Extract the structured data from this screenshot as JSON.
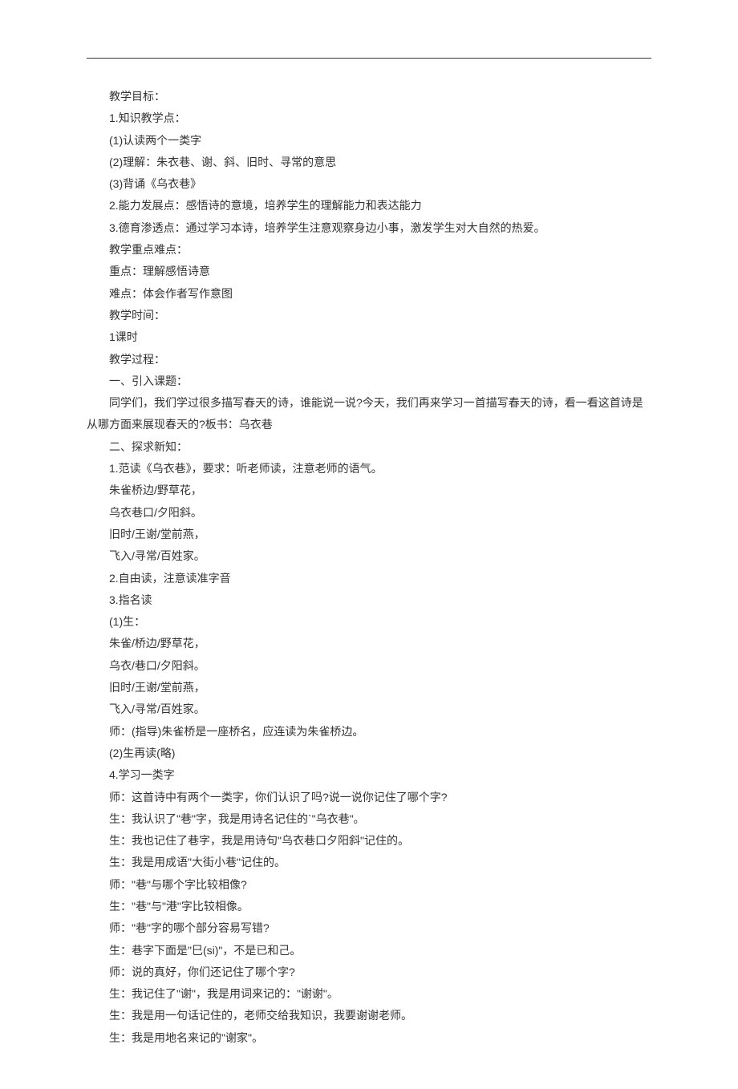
{
  "lines": [
    "教学目标：",
    "1.知识教学点：",
    "(1)认读两个一类字",
    "(2)理解：朱衣巷、谢、斜、旧时、寻常的意思",
    "(3)背诵《乌衣巷》",
    "2.能力发展点：感悟诗的意境，培养学生的理解能力和表达能力",
    "3.德育渗透点：通过学习本诗，培养学生注意观察身边小事，激发学生对大自然的热爱。",
    "教学重点难点：",
    "重点：理解感悟诗意",
    "难点：体会作者写作意图",
    "教学时间：",
    "1课时",
    "教学过程：",
    "一、引入课题：",
    "同学们，我们学过很多描写春天的诗，谁能说一说?今天，我们再来学习一首描写春天的诗，看一看这首诗是从哪方面来展现春天的?板书：乌衣巷",
    "二、探求新知：",
    "1.范读《乌衣巷》，要求：听老师读，注意老师的语气。",
    "朱雀桥边/野草花，",
    "乌衣巷口/夕阳斜。",
    "旧时/王谢/堂前燕，",
    "飞入/寻常/百姓家。",
    "2.自由读，注意读准字音",
    "3.指名读",
    "(1)生：",
    "朱雀/桥边/野草花，",
    "乌衣/巷口/夕阳斜。",
    "旧时/王谢/堂前燕，",
    "飞入/寻常/百姓家。",
    "师：(指导)朱雀桥是一座桥名，应连读为朱雀桥边。",
    "(2)生再读(略)",
    "4.学习一类字",
    "师：这首诗中有两个一类字，你们认识了吗?说一说你记住了哪个字?",
    "生：我认识了\"巷\"字，我是用诗名记住的`\"乌衣巷\"。",
    "生：我也记住了巷字，我是用诗句\"乌衣巷口夕阳斜\"记住的。",
    "生：我是用成语\"大街小巷\"记住的。",
    "师：\"巷\"与哪个字比较相像?",
    "生：\"巷\"与\"港\"字比较相像。",
    "师：\"巷\"字的哪个部分容易写错?",
    "生：巷字下面是\"巳(si)\"，不是已和己。",
    "师：说的真好，你们还记住了哪个字?",
    "生：我记住了\"谢\"，我是用词来记的：\"谢谢\"。",
    "生：我是用一句话记住的，老师交给我知识，我要谢谢老师。",
    "生：我是用地名来记的\"谢家\"。"
  ],
  "wrap_index": 14
}
